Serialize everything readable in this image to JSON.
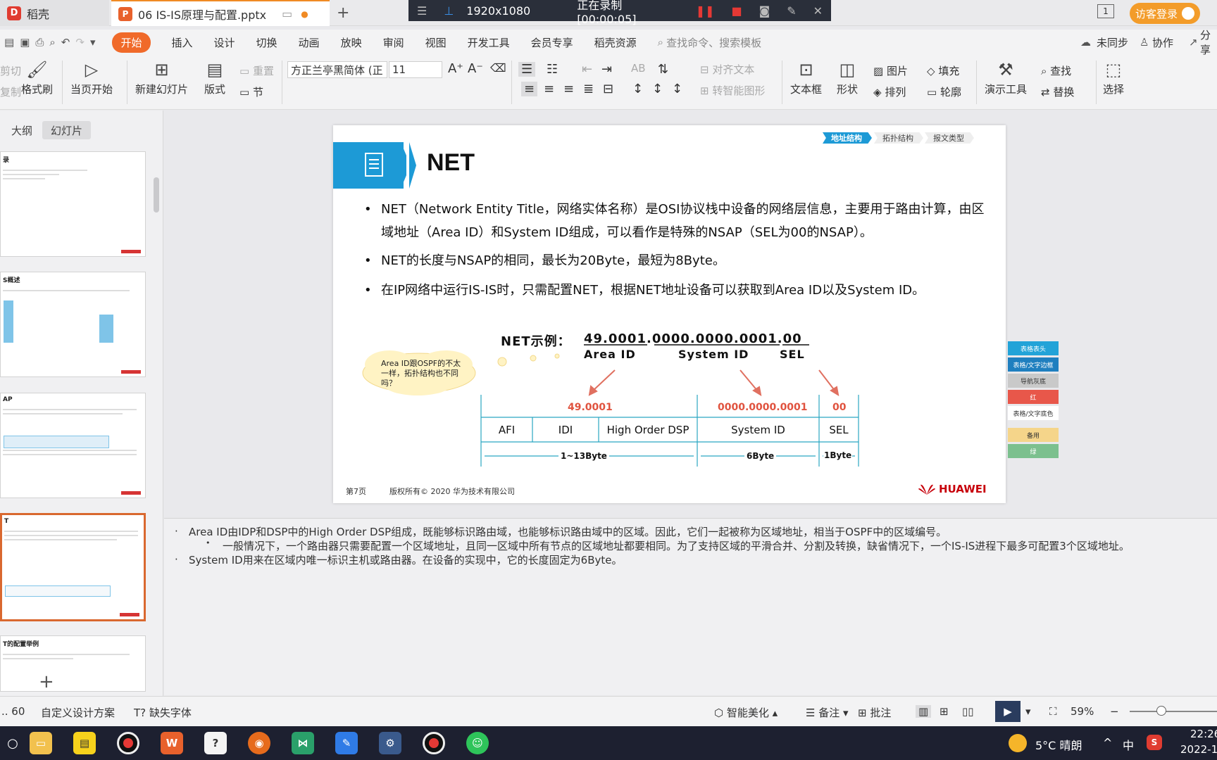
{
  "titlebar": {
    "home_tab": "稻壳",
    "doc_tab": "06 IS-IS原理与配置.pptx",
    "new_tab": "+",
    "resolution": "1920x1080",
    "recording": "正在录制 [00:00:05]",
    "page_badge": "1",
    "login": "访客登录"
  },
  "menu": {
    "items": [
      "开始",
      "插入",
      "设计",
      "切换",
      "动画",
      "放映",
      "审阅",
      "视图",
      "开发工具",
      "会员专享",
      "稻壳资源"
    ],
    "search_placeholder": "查找命令、搜索模板",
    "sync": "未同步",
    "collab": "协作",
    "share": "分享"
  },
  "ribbon": {
    "cut": "剪切",
    "copy": "复制",
    "format_painter": "格式刷",
    "play_current": "当页开始",
    "new_slide": "新建幻灯片",
    "layout": "版式",
    "section": "节",
    "reset": "重置",
    "font_name": "方正兰亭黑简体 (正",
    "font_size": "11",
    "align_text": "对齐文本",
    "smart_shape": "转智能图形",
    "textbox": "文本框",
    "shape": "形状",
    "picture": "图片",
    "arrange": "排列",
    "fill": "填充",
    "outline": "轮廓",
    "present_tools": "演示工具",
    "find": "查找",
    "replace": "替换",
    "select": "选择"
  },
  "left_panel": {
    "tab_outline": "大纲",
    "tab_slides": "幻灯片",
    "thumbs": [
      {
        "title": "录"
      },
      {
        "title": "S概述"
      },
      {
        "title": "AP"
      },
      {
        "title": "T"
      },
      {
        "title": "T的配置举例"
      }
    ],
    "add": "+"
  },
  "slide": {
    "title": "NET",
    "breadcrumbs": [
      "地址结构",
      "拓扑结构",
      "报文类型"
    ],
    "bullets": [
      "NET（Network Entity Title，网络实体名称）是OSI协议栈中设备的网络层信息，主要用于路由计算，由区域地址（Area ID）和System ID组成，可以看作是特殊的NSAP（SEL为00的NSAP）。",
      "NET的长度与NSAP的相同，最长为20Byte，最短为8Byte。",
      "在IP网络中运行IS-IS时，只需配置NET，根据NET地址设备可以获取到Area ID以及System ID。"
    ],
    "example_label": "NET示例：",
    "example_addr": "49.0001.0000.0000.0001.00",
    "area_label": "Area ID",
    "sysid_label": "System ID",
    "sel_label": "SEL",
    "cloud_text": "Area ID跟OSPF的不太一样，拓扑结构也不同吗？",
    "value_area": "49.0001",
    "value_sysid": "0000.0000.0001",
    "value_sel": "00",
    "fields": [
      "AFI",
      "IDI",
      "High Order DSP",
      "System ID",
      "SEL"
    ],
    "len_area": "1~13Byte",
    "len_sysid": "6Byte",
    "len_sel": "1Byte",
    "page": "第7页",
    "copyright": "版权所有© 2020 华为技术有限公司",
    "logo": "HUAWEI"
  },
  "palette": {
    "items": [
      "表格表头",
      "表格/文字边框",
      "导航灰底",
      "红",
      "表格/文字底色",
      "备用",
      "绿"
    ],
    "colors": [
      "#22a3d8",
      "#1f7fbf",
      "#c9c9c9",
      "#e8574a",
      "#ffffff",
      "#f5d58a",
      "#7cc08e"
    ]
  },
  "notes": {
    "lines": [
      "Area ID由IDP和DSP中的High Order DSP组成，既能够标识路由域，也能够标识路由域中的区域。因此，它们一起被称为区域地址，相当于OSPF中的区域编号。",
      "一般情况下，一个路由器只需要配置一个区域地址，且同一区域中所有节点的区域地址都要相同。为了支持区域的平滑合并、分割及转换，缺省情况下，一个IS-IS进程下最多可配置3个区域地址。",
      "System ID用来在区域内唯一标识主机或路由器。在设备的实现中，它的长度固定为6Byte。"
    ]
  },
  "status": {
    "slide_count": ".. 60",
    "design": "自定义设计方案",
    "missing_font": "缺失字体",
    "beautify": "智能美化",
    "notes": "备注",
    "comment": "批注",
    "zoom": "59%"
  },
  "taskbar": {
    "weather": "5°C 晴朗",
    "ime": "中",
    "time": "22:26",
    "date": "2022-1"
  }
}
